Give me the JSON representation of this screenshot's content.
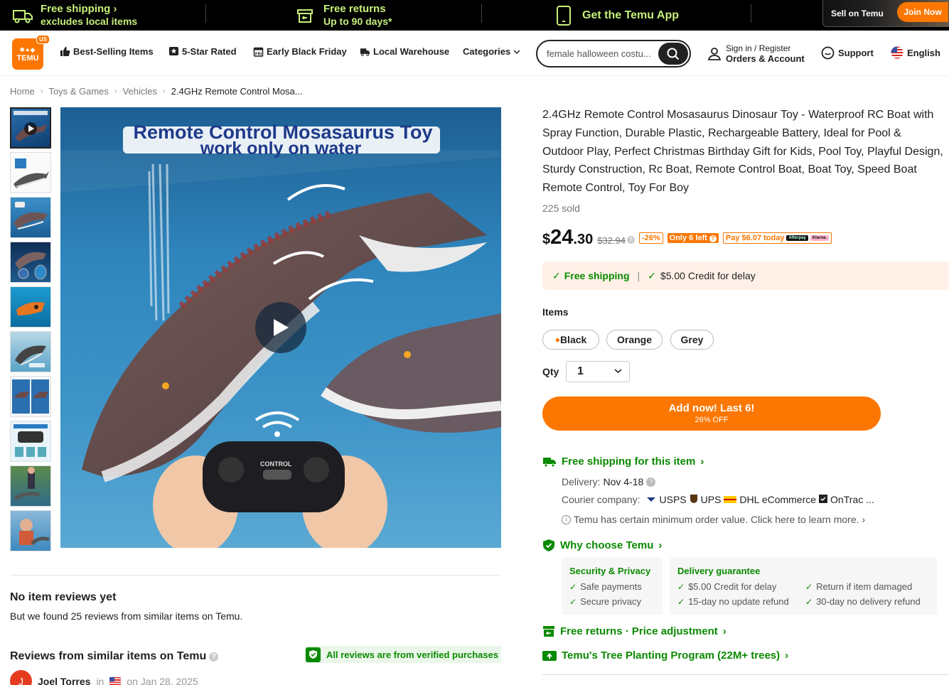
{
  "promo": {
    "free_shipping": "Free shipping",
    "free_shipping_sub": "excludes local items",
    "free_returns": "Free returns",
    "free_returns_sub": "Up to 90 days*",
    "app": "Get the Temu App",
    "sell": "Sell on Temu",
    "join": "Join Now"
  },
  "header": {
    "logo_text": "TEMU",
    "logo_region": "US",
    "nav": [
      "Best-Selling Items",
      "5-Star Rated",
      "Early Black Friday",
      "Local Warehouse",
      "Categories"
    ],
    "search_value": "female halloween costu...",
    "sign_in": "Sign in / Register",
    "orders": "Orders & Account",
    "support": "Support",
    "language": "English"
  },
  "breadcrumb": [
    "Home",
    "Toys & Games",
    "Vehicles",
    "2.4GHz Remote Control Mosa..."
  ],
  "gallery": {
    "image_title_line1": "Remote Control Mosasaurus Toy",
    "image_title_line2": "work only on water",
    "controller_label": "CONTROL"
  },
  "reviews": {
    "no_reviews": "No item reviews yet",
    "found": "But we found 25 reviews from similar items on Temu.",
    "similar_title": "Reviews from similar items on Temu",
    "verified": "All reviews are from verified purchases",
    "reviewer_initial": "J",
    "reviewer_name": "Joel Torres",
    "reviewer_in": "in",
    "reviewer_date": "on Jan 28, 2025"
  },
  "product": {
    "title": "2.4GHz Remote Control Mosasaurus Dinosaur Toy - Waterproof RC Boat with Spray Function, Durable Plastic, Rechargeable Battery, Ideal for Pool & Outdoor Play, Perfect Christmas Birthday Gift for Kids, Pool Toy, Playful Design, Sturdy Construction, Rc Boat, Remote Control Boat, Boat Toy, Speed Boat Remote Control, Toy For Boy",
    "sold": "225 sold",
    "price_symbol": "$",
    "price_whole": "24",
    "price_cents": ".30",
    "original_price": "$32.94",
    "discount": "-26%",
    "stock_badge": "Only 6 left",
    "pay_today": "Pay $6.07 today",
    "afterpay": "Afterpay",
    "klarna": "Klarna.",
    "free_shipping": "Free shipping",
    "credit": "$5.00 Credit for delay",
    "items_label": "Items",
    "options": [
      "Black",
      "Orange",
      "Grey"
    ],
    "qty_label": "Qty",
    "qty_value": "1",
    "add_button": "Add now! Last 6!",
    "add_button_sub": "26% OFF"
  },
  "shipping": {
    "title": "Free shipping for this item",
    "delivery_label": "Delivery:",
    "delivery_value": "Nov 4-18",
    "courier_label": "Courier company:",
    "couriers": [
      "USPS",
      "UPS",
      "DHL eCommerce",
      "OnTrac ..."
    ],
    "min_order": "Temu has certain minimum order value. Click here to learn more."
  },
  "why": {
    "title": "Why choose Temu",
    "security_title": "Security & Privacy",
    "security_items": [
      "Safe payments",
      "Secure privacy"
    ],
    "delivery_title": "Delivery guarantee",
    "delivery_items": [
      "$5.00 Credit for delay",
      "15-day no update refund",
      "Return if item damaged",
      "30-day no delivery refund"
    ]
  },
  "returns": "Free returns · Price adjustment",
  "tree": "Temu's Tree Planting Program (22M+ trees)",
  "colors": {
    "brand_orange": "#fb7701",
    "green": "#0a8a00",
    "promo_green": "#c5f07a"
  }
}
